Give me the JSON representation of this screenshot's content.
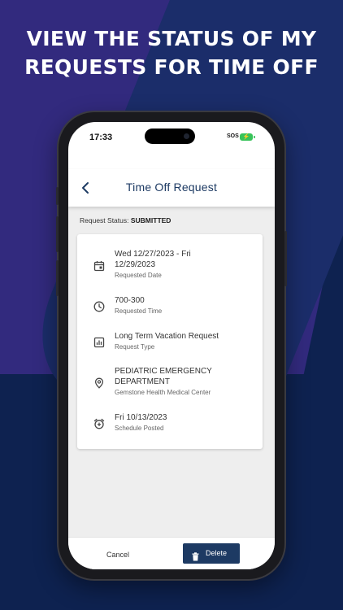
{
  "headline": {
    "line1": "VIEW THE STATUS OF MY",
    "line2": "REQUESTS FOR TIME OFF"
  },
  "status_bar": {
    "time": "17:33",
    "carrier": "SOS"
  },
  "nav": {
    "title": "Time Off Request"
  },
  "request_status": {
    "label": "Request Status:",
    "value": "SUBMITTED"
  },
  "details": [
    {
      "icon": "calendar-icon",
      "main1": "Wed 12/27/2023 - Fri",
      "main2": "12/29/2023",
      "sub": "Requested Date"
    },
    {
      "icon": "clock-icon",
      "main1": "700-300",
      "main2": "",
      "sub": "Requested Time"
    },
    {
      "icon": "chart-icon",
      "main1": "Long Term Vacation Request",
      "main2": "",
      "sub": "Request Type"
    },
    {
      "icon": "location-pin-icon",
      "main1": "PEDIATRIC EMERGENCY",
      "main2": "DEPARTMENT",
      "sub": "Gemstone Health Medical Center"
    },
    {
      "icon": "alarm-add-icon",
      "main1": "Fri 10/13/2023",
      "main2": "",
      "sub": "Schedule Posted"
    }
  ],
  "footer": {
    "cancel_label": "Cancel",
    "delete_label": "Delete"
  },
  "colors": {
    "brand_navy": "#1d3a63",
    "battery": "#38c35a",
    "background": "#0e2250",
    "accent_purple": "#322a7e"
  }
}
